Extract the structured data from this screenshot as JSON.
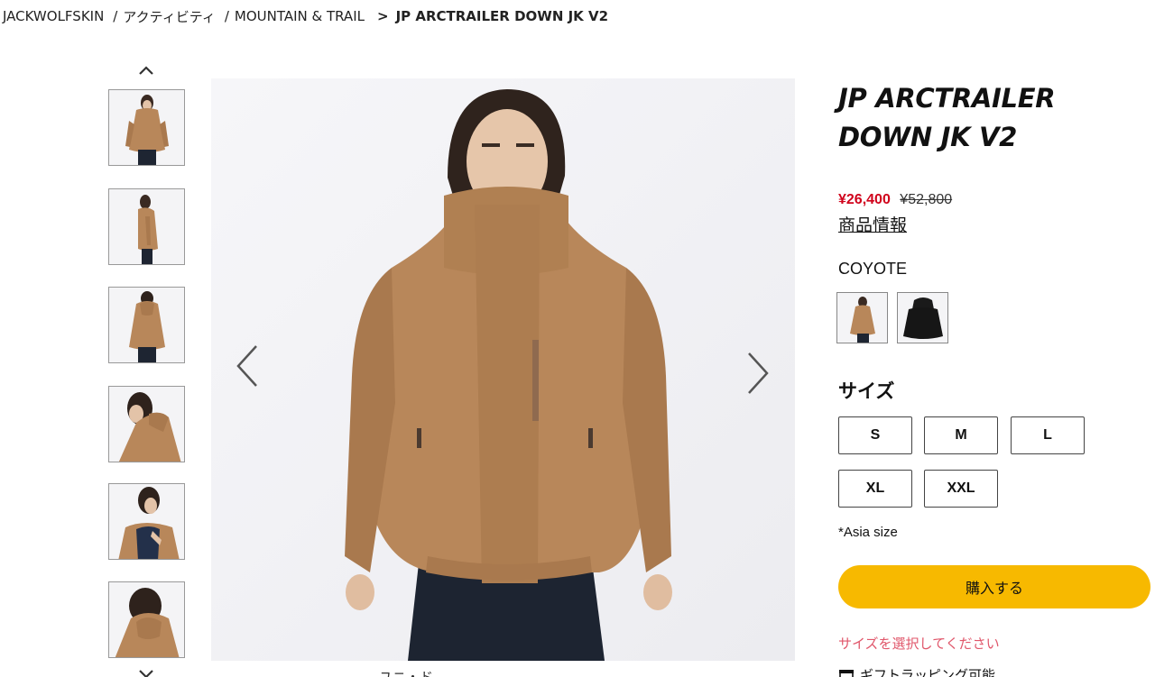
{
  "breadcrumb": {
    "items": [
      "JACKWOLFSKIN",
      "アクティビティ",
      "MOUNTAIN & TRAIL",
      "JP ARCTRAILER DOWN JK V2"
    ],
    "separator": "/",
    "current_separator": ">"
  },
  "gallery": {
    "thumbnails": [
      {
        "icon": "jacket-front-thumb"
      },
      {
        "icon": "jacket-side-thumb"
      },
      {
        "icon": "jacket-back-thumb"
      },
      {
        "icon": "jacket-hood-side-thumb"
      },
      {
        "icon": "jacket-open-thumb"
      },
      {
        "icon": "jacket-hood-back-thumb"
      }
    ],
    "caption_partial": "ユニ・ド"
  },
  "product": {
    "title": "JP ARCTRAILER DOWN JK V2",
    "price_sale": "¥26,400",
    "price_original": "¥52,800",
    "info_link": "商品情報",
    "color_name": "COYOTE",
    "size_heading": "サイズ",
    "sizes": [
      "S",
      "M",
      "L",
      "XL",
      "XXL"
    ],
    "size_note": "*Asia size",
    "buy_label": "購入する",
    "select_message": "サイズを選択してください",
    "gift_label": "ギフトラッピング可能"
  },
  "colors": {
    "sale": "#d0021b",
    "buy_button": "#f7b900",
    "warning": "#e0566a",
    "jacket": "#b8875a"
  }
}
